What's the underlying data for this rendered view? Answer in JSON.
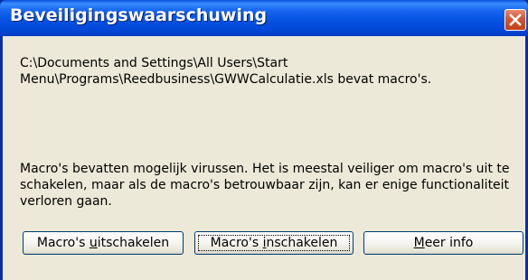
{
  "dialog": {
    "title": "Beveiligingswaarschuwing",
    "message_path": "C:\\Documents and Settings\\All Users\\Start Menu\\Programs\\Reedbusiness\\GWWCalculatie.xls bevat macro's.",
    "message_warning": "Macro's bevatten mogelijk virussen. Het is meestal veiliger om macro's uit te schakelen, maar als de macro's betrouwbaar zijn, kan er enige functionaliteit verloren gaan."
  },
  "buttons": {
    "disable": {
      "pre": "Macro's ",
      "accel": "u",
      "post": "itschakelen"
    },
    "enable": {
      "pre": "Macro's ",
      "accel": "i",
      "post": "nschakelen"
    },
    "info": {
      "pre": "",
      "accel": "M",
      "post": "eer info"
    }
  },
  "icons": {
    "close": "close-icon"
  },
  "colors": {
    "titlebar": "#0553e2",
    "frame": "#0a2ea8",
    "client": "#ece9d8",
    "close": "#d3542f"
  }
}
